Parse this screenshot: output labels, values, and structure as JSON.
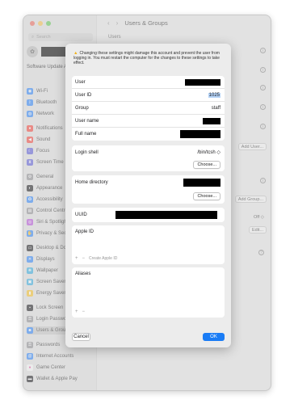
{
  "sidebar": {
    "search_placeholder": "Search",
    "software_update": "Software Update Available",
    "software_update_badge": "1",
    "items": [
      {
        "label": "Wi-Fi",
        "icon": "wifi-icon",
        "color": "#2f83f6",
        "glyph": "◉"
      },
      {
        "label": "Bluetooth",
        "icon": "bluetooth-icon",
        "color": "#2f83f6",
        "glyph": "ᛒ"
      },
      {
        "label": "Network",
        "icon": "globe-icon",
        "color": "#2f83f6",
        "glyph": "◍"
      },
      {
        "label": "Notifications",
        "icon": "bell-icon",
        "color": "#f1453d",
        "glyph": "●"
      },
      {
        "label": "Sound",
        "icon": "speaker-icon",
        "color": "#f1453d",
        "glyph": "◀"
      },
      {
        "label": "Focus",
        "icon": "moon-icon",
        "color": "#5b5bd6",
        "glyph": "☾"
      },
      {
        "label": "Screen Time",
        "icon": "hourglass-icon",
        "color": "#5b5bd6",
        "glyph": "⧗"
      },
      {
        "label": "General",
        "icon": "gear-icon",
        "color": "#8e8e93",
        "glyph": "⚙"
      },
      {
        "label": "Appearance",
        "icon": "appearance-icon",
        "color": "#1d1d1f",
        "glyph": "◐"
      },
      {
        "label": "Accessibility",
        "icon": "accessibility-icon",
        "color": "#2f83f6",
        "glyph": "✪"
      },
      {
        "label": "Control Centre",
        "icon": "control-centre-icon",
        "color": "#8e8e93",
        "glyph": "▤"
      },
      {
        "label": "Siri & Spotlight",
        "icon": "siri-icon",
        "color": "#b452d8",
        "glyph": "◎"
      },
      {
        "label": "Privacy & Security",
        "icon": "hand-icon",
        "color": "#2f83f6",
        "glyph": "✋"
      },
      {
        "label": "Desktop & Dock",
        "icon": "dock-icon",
        "color": "#1d1d1f",
        "glyph": "▭"
      },
      {
        "label": "Displays",
        "icon": "sun-icon",
        "color": "#2f83f6",
        "glyph": "☀"
      },
      {
        "label": "Wallpaper",
        "icon": "wallpaper-icon",
        "color": "#34aadc",
        "glyph": "❋"
      },
      {
        "label": "Screen Saver",
        "icon": "screensaver-icon",
        "color": "#34aadc",
        "glyph": "▣"
      },
      {
        "label": "Energy Saver",
        "icon": "battery-icon",
        "color": "#f4bf2a",
        "glyph": "▮"
      },
      {
        "label": "Lock Screen",
        "icon": "lock-icon",
        "color": "#1d1d1f",
        "glyph": "▪"
      },
      {
        "label": "Login Password",
        "icon": "key-icon",
        "color": "#8e8e93",
        "glyph": "⚿"
      },
      {
        "label": "Users & Groups",
        "icon": "users-icon",
        "color": "#2f83f6",
        "glyph": "☻"
      },
      {
        "label": "Passwords",
        "icon": "key-icon",
        "color": "#8e8e93",
        "glyph": "⚿"
      },
      {
        "label": "Internet Accounts",
        "icon": "at-icon",
        "color": "#2f83f6",
        "glyph": "@"
      },
      {
        "label": "Game Center",
        "icon": "gamecenter-icon",
        "color": "#f4f4f4",
        "glyph": "●"
      },
      {
        "label": "Wallet & Apple Pay",
        "icon": "wallet-icon",
        "color": "#1d1d1f",
        "glyph": "▬"
      }
    ]
  },
  "main": {
    "title": "Users & Groups",
    "subtitle": "Users",
    "add_user_label": "Add User...",
    "add_group_label": "Add Group...",
    "off_label": "Off ◇",
    "edit_label": "Edit...",
    "help_label": "?"
  },
  "sheet": {
    "warning": "Changing these settings might damage this account and prevent the user from logging in. You must restart the computer for the changes to these settings to take effect.",
    "user_label": "User",
    "user_id_label": "User ID",
    "user_id_value": "1025",
    "group_label": "Group",
    "group_value": "staff",
    "user_name_label": "User name",
    "full_name_label": "Full name",
    "login_shell_label": "Login shell",
    "login_shell_value": "/bin/tcsh ◇",
    "choose_label": "Choose...",
    "home_directory_label": "Home directory",
    "uuid_label": "UUID",
    "apple_id_label": "Apple ID",
    "create_apple_id_label": "Create Apple ID",
    "aliases_label": "Aliases",
    "plus": "+",
    "minus": "−",
    "cancel_label": "Cancel",
    "ok_label": "OK"
  }
}
